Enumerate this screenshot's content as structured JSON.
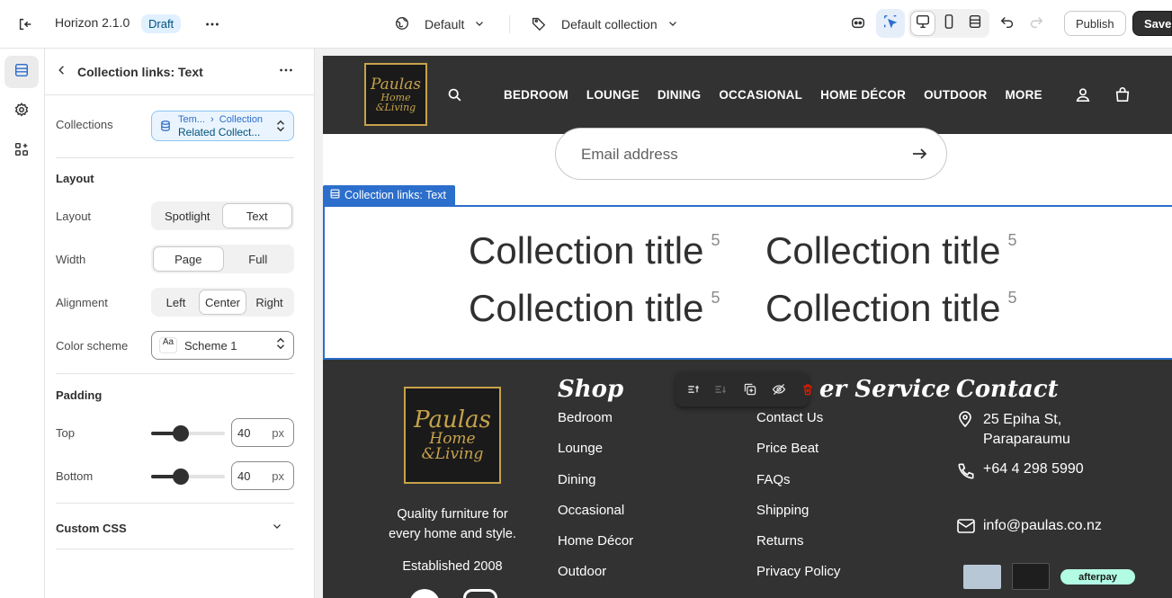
{
  "topbar": {
    "theme_name": "Horizon 2.1.0",
    "status_badge": "Draft",
    "template_select": "Default",
    "collection_select": "Default collection",
    "publish_label": "Publish",
    "save_label": "Save"
  },
  "panel": {
    "title": "Collection links: Text",
    "collections": {
      "label": "Collections",
      "breadcrumb_a": "Tem...",
      "breadcrumb_b": "Collection",
      "value": "Related Collect..."
    },
    "layout_section": "Layout",
    "layout": {
      "label": "Layout",
      "options": [
        "Spotlight",
        "Text"
      ],
      "selected": "Text"
    },
    "width": {
      "label": "Width",
      "options": [
        "Page",
        "Full"
      ],
      "selected": "Page"
    },
    "alignment": {
      "label": "Alignment",
      "options": [
        "Left",
        "Center",
        "Right"
      ],
      "selected": "Center"
    },
    "color_scheme": {
      "label": "Color scheme",
      "swatch": "Aa",
      "value": "Scheme 1"
    },
    "padding_section": "Padding",
    "top": {
      "label": "Top",
      "value": "40",
      "unit": "px",
      "fraction": 0.4
    },
    "bottom": {
      "label": "Bottom",
      "value": "40",
      "unit": "px",
      "fraction": 0.4
    },
    "custom_css": "Custom CSS"
  },
  "preview": {
    "logo": {
      "line1": "Paulas",
      "line2": "Home",
      "line3": "&Living"
    },
    "nav": [
      "BEDROOM",
      "LOUNGE",
      "DINING",
      "OCCASIONAL",
      "HOME DÉCOR",
      "OUTDOOR",
      "MORE"
    ],
    "email_placeholder": "Email address",
    "section_tag": "Collection links: Text",
    "collections": [
      {
        "title": "Collection title",
        "count": "5"
      },
      {
        "title": "Collection title",
        "count": "5"
      },
      {
        "title": "Collection title",
        "count": "5"
      },
      {
        "title": "Collection title",
        "count": "5"
      }
    ],
    "footer": {
      "tagline": "Quality furniture for every home and style.",
      "established": "Established 2008",
      "shop_heading": "Shop",
      "shop_links": [
        "Bedroom",
        "Lounge",
        "Dining",
        "Occasional",
        "Home Décor",
        "Outdoor"
      ],
      "service_heading": "er Service",
      "service_links": [
        "Contact Us",
        "Price Beat",
        "FAQs",
        "Shipping",
        "Returns",
        "Privacy Policy"
      ],
      "contact_heading": "Contact",
      "address": "25 Epiha St, Paraparaumu",
      "phone": "+64 4 298 5990",
      "email": "info@paulas.co.nz",
      "afterpay": "afterpay"
    }
  },
  "colors": {
    "accent": "#2c6ecb",
    "gold": "#c6a24b",
    "dark": "#323232"
  }
}
